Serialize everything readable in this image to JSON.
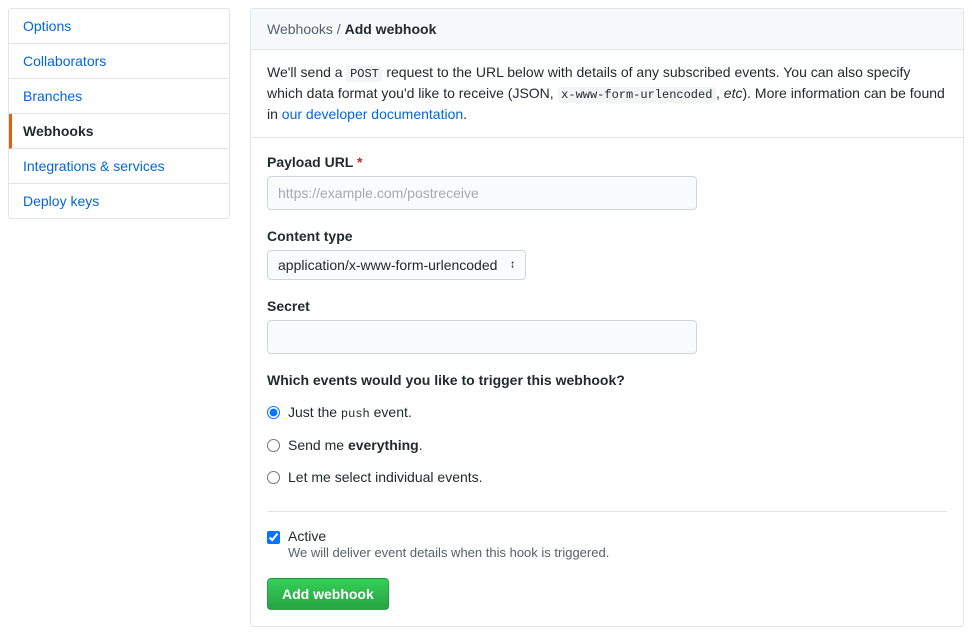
{
  "sidebar": {
    "items": [
      {
        "label": "Options",
        "active": false
      },
      {
        "label": "Collaborators",
        "active": false
      },
      {
        "label": "Branches",
        "active": false
      },
      {
        "label": "Webhooks",
        "active": true
      },
      {
        "label": "Integrations & services",
        "active": false
      },
      {
        "label": "Deploy keys",
        "active": false
      }
    ]
  },
  "breadcrumb": {
    "parent": "Webhooks",
    "separator": " / ",
    "current": "Add webhook"
  },
  "description": {
    "prefix": "We'll send a ",
    "code1": "POST",
    "mid1": " request to the URL below with details of any subscribed events. You can also specify which data format you'd like to receive (JSON, ",
    "code2": "x-www-form-urlencoded",
    "mid2": ", ",
    "italic": "etc",
    "mid3": "). More information can be found in ",
    "link": "our developer documentation",
    "suffix": "."
  },
  "form": {
    "payload_url": {
      "label": "Payload URL",
      "required": "*",
      "placeholder": "https://example.com/postreceive",
      "value": ""
    },
    "content_type": {
      "label": "Content type",
      "selected": "application/x-www-form-urlencoded"
    },
    "secret": {
      "label": "Secret",
      "value": ""
    },
    "events": {
      "label": "Which events would you like to trigger this webhook?",
      "options": {
        "push_pre": "Just the ",
        "push_code": "push",
        "push_post": " event.",
        "everything_pre": "Send me ",
        "everything_strong": "everything",
        "everything_post": ".",
        "individual": "Let me select individual events."
      }
    },
    "active": {
      "label": "Active",
      "description": "We will deliver event details when this hook is triggered."
    },
    "submit": "Add webhook"
  }
}
